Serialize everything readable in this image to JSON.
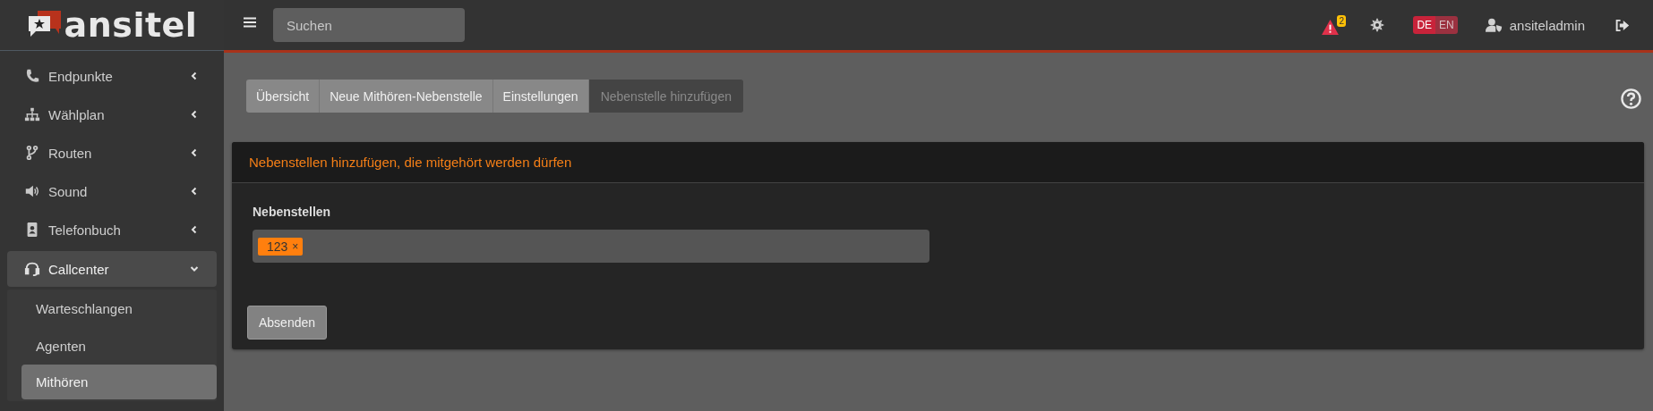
{
  "brand": {
    "name": "ansitel"
  },
  "topbar": {
    "search": {
      "placeholder": "Suchen"
    },
    "alerts": {
      "count": "2"
    },
    "languages": [
      {
        "label": "DE",
        "selected": true
      },
      {
        "label": "EN",
        "selected": false
      }
    ],
    "user": "ansiteladmin"
  },
  "sidebar": {
    "items": [
      {
        "label": "Endpunkte",
        "expanded": false
      },
      {
        "label": "Wählplan",
        "expanded": false
      },
      {
        "label": "Routen",
        "expanded": false
      },
      {
        "label": "Sound",
        "expanded": false
      },
      {
        "label": "Telefonbuch",
        "expanded": false
      },
      {
        "label": "Callcenter",
        "expanded": true,
        "children": [
          {
            "label": "Warteschlangen",
            "selected": false
          },
          {
            "label": "Agenten",
            "selected": false
          },
          {
            "label": "Mithören",
            "selected": true
          }
        ]
      }
    ]
  },
  "breadcrumb": [
    {
      "label": "Übersicht",
      "active": false
    },
    {
      "label": "Neue Mithören-Nebenstelle",
      "active": false
    },
    {
      "label": "Einstellungen",
      "active": false
    },
    {
      "label": "Nebenstelle hinzufügen",
      "active": true
    }
  ],
  "card": {
    "title": "Nebenstellen hinzufügen, die mitgehört werden dürfen",
    "field": {
      "label": "Nebenstellen",
      "tags": [
        {
          "label": "123",
          "remove": "×"
        }
      ]
    },
    "submit": "Absenden"
  }
}
